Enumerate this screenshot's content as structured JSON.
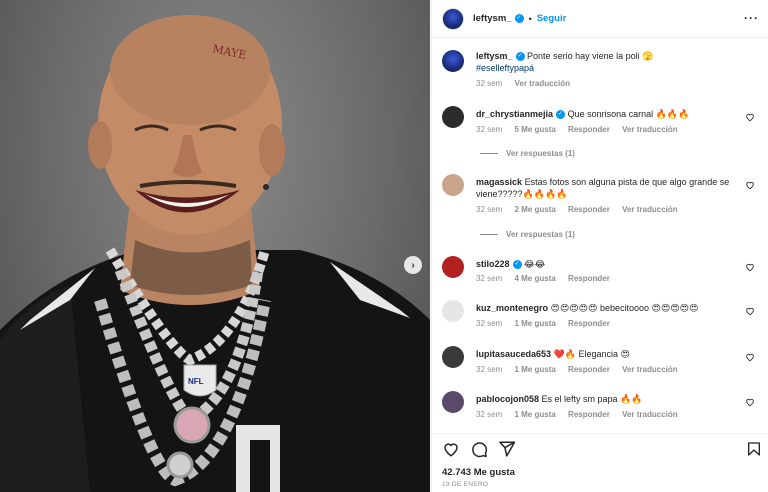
{
  "post": {
    "username": "leftysm_",
    "follow_label": "Seguir",
    "caption_text": "Ponte serio hay viene la poli 🫣",
    "caption_hashtag": "#eselleftypapá",
    "caption_time": "32 sem",
    "caption_translate": "Ver traducción",
    "likes": "42.743 Me gusta",
    "date": "19 DE ENERO"
  },
  "comments": [
    {
      "user": "dr_chrystianmejia",
      "text": "Que sonrisona carnal 🔥🔥🔥",
      "time": "32 sem",
      "likes": "5 Me gusta",
      "reply": "Responder",
      "translate": "Ver traducción",
      "view_replies": "Ver respuestas (1)",
      "avatar_color": "#2b2b2b"
    },
    {
      "user": "magassick",
      "text": "Estas fotos son alguna pista de que algo grande se viene?????🔥🔥🔥🔥",
      "time": "32 sem",
      "likes": "2 Me gusta",
      "reply": "Responder",
      "translate": "Ver traducción",
      "view_replies": "Ver respuestas (1)",
      "avatar_color": "#c9a48a"
    },
    {
      "user": "stilo228",
      "text": "😂😂",
      "time": "32 sem",
      "likes": "4 Me gusta",
      "reply": "Responder",
      "avatar_color": "#b32020"
    },
    {
      "user": "kuz_montenegro",
      "text": "😍😍😍😍😍 bebecitoooo 😍😍😍😍😍",
      "time": "32 sem",
      "likes": "1 Me gusta",
      "reply": "Responder",
      "avatar_color": "#e6e6e6"
    },
    {
      "user": "lupitasauceda653",
      "text": "❤️🔥 Elegancia 😍",
      "time": "32 sem",
      "likes": "1 Me gusta",
      "reply": "Responder",
      "translate": "Ver traducción",
      "avatar_color": "#3a3a3a"
    },
    {
      "user": "pablocojon058",
      "text": "Es el lefty sm papa 🔥🔥",
      "time": "32 sem",
      "likes": "1 Me gusta",
      "reply": "Responder",
      "translate": "Ver traducción",
      "avatar_color": "#5a4a6a"
    }
  ],
  "icons": {
    "more": "more-options-icon",
    "like": "heart-icon",
    "comment": "comment-icon",
    "share": "share-icon",
    "save": "bookmark-icon",
    "next": "chevron-right-icon"
  },
  "colors": {
    "accent": "#0095f6",
    "muted": "#8e8e8e",
    "text": "#262626"
  }
}
